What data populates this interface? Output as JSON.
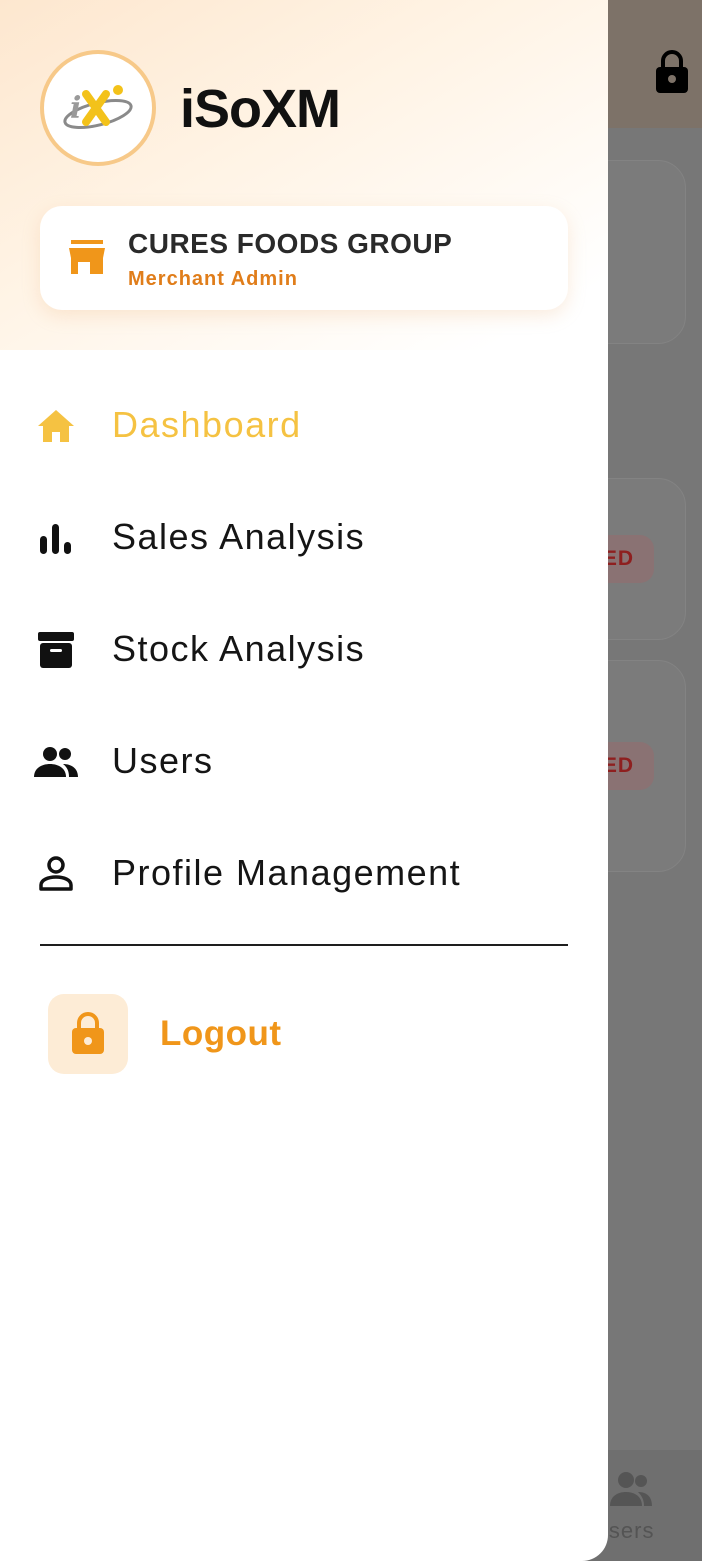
{
  "colors": {
    "accent": "#f5c242",
    "brand_orange": "#f0961a",
    "merchant_role": "#e07d1a",
    "text": "#151515",
    "scrim": "#777777"
  },
  "background_app": {
    "header_icon": "lock-icon",
    "status_badges": [
      "ED",
      "ED"
    ],
    "bottom_nav": {
      "users_label": "Users",
      "users_icon": "users-icon"
    }
  },
  "drawer": {
    "app_name": "iSoXM",
    "logo_icon": "ix-logo",
    "merchant": {
      "icon": "store-icon",
      "name": "CURES FOODS GROUP",
      "role": "Merchant Admin"
    },
    "menu": [
      {
        "label": "Dashboard",
        "icon": "home-icon",
        "active": true
      },
      {
        "label": "Sales Analysis",
        "icon": "bar-chart-icon",
        "active": false
      },
      {
        "label": "Stock Analysis",
        "icon": "archive-box-icon",
        "active": false
      },
      {
        "label": "Users",
        "icon": "users-icon",
        "active": false
      },
      {
        "label": "Profile Management",
        "icon": "person-icon",
        "active": false
      }
    ],
    "logout": {
      "label": "Logout",
      "icon": "lock-icon"
    }
  }
}
